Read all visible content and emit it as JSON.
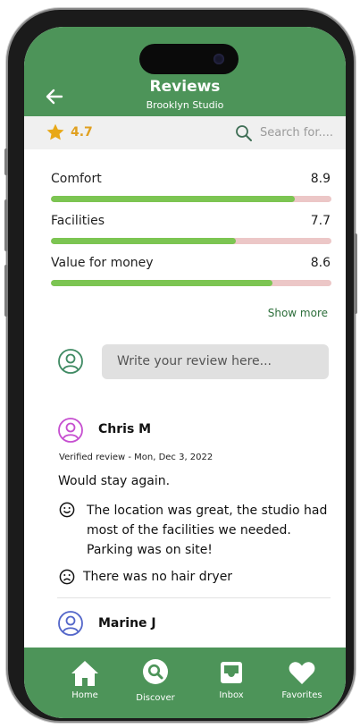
{
  "header": {
    "title": "Reviews",
    "subtitle": "Brooklyn Studio"
  },
  "toolbar": {
    "rating": "4.7",
    "search_placeholder": "Search for...."
  },
  "metrics": [
    {
      "label": "Comfort",
      "value": "8.9",
      "fill_fraction": 0.87
    },
    {
      "label": "Facilities",
      "value": "7.7",
      "fill_fraction": 0.66
    },
    {
      "label": "Value for money",
      "value": "8.6",
      "fill_fraction": 0.79
    }
  ],
  "show_more": "Show more",
  "write_review": {
    "placeholder": "Write your review here..."
  },
  "reviews": [
    {
      "name": "Chris M",
      "meta": "Verified review - Mon, Dec 3, 2022",
      "headline": "Would stay again.",
      "positive": "The location was great, the studio had most of the facilities we needed. Parking was on site!",
      "negative": "There was no hair dryer"
    },
    {
      "name": "Marine J"
    }
  ],
  "tabs": [
    {
      "label": "Home",
      "icon": "home-icon"
    },
    {
      "label": "Discover",
      "icon": "discover-icon"
    },
    {
      "label": "Inbox",
      "icon": "inbox-icon"
    },
    {
      "label": "Favorites",
      "icon": "heart-icon"
    }
  ],
  "colors": {
    "primary": "#4d9459",
    "bar_fill": "#7cc552",
    "bar_track": "#ecc7c7",
    "star": "#e0a020"
  }
}
